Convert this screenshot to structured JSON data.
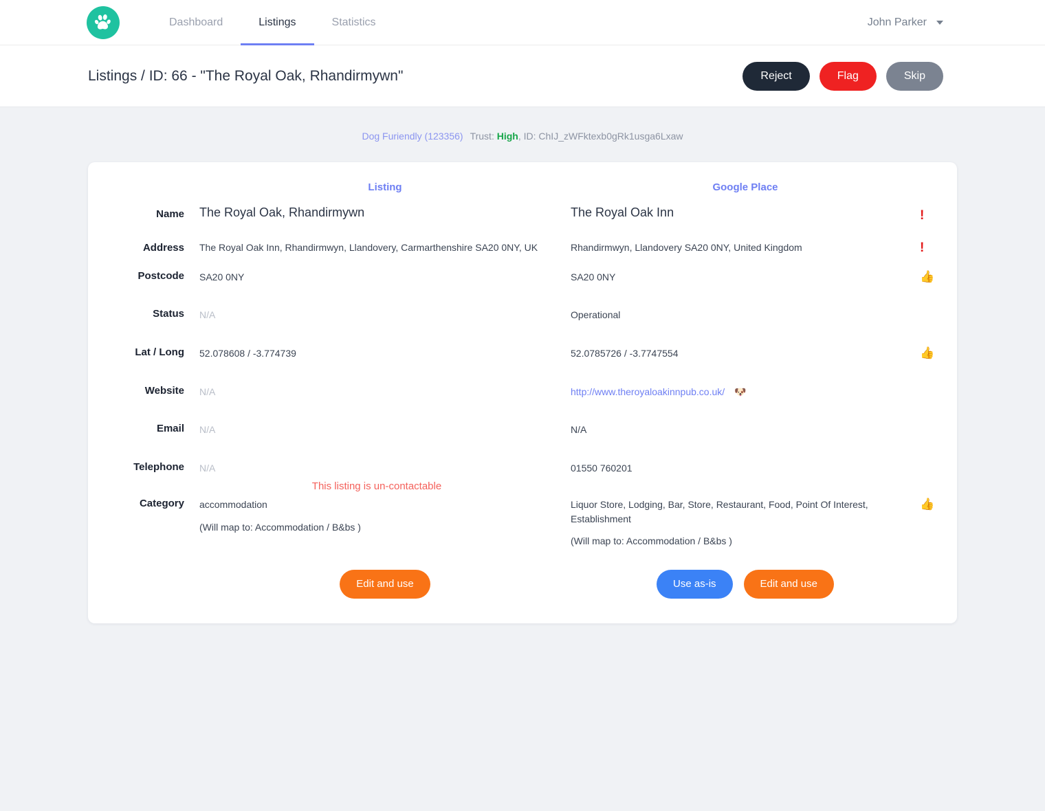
{
  "nav": {
    "logo_icon": "paw-print-icon",
    "brand_color": "#1fc2a0",
    "links": [
      {
        "label": "Dashboard",
        "active": false
      },
      {
        "label": "Listings",
        "active": true
      },
      {
        "label": "Statistics",
        "active": false
      }
    ],
    "user": "John Parker",
    "caret_icon": "chevron-down-icon"
  },
  "page": {
    "title": "Listings / ID: 66 - \"The Royal Oak, Rhandirmywn\"",
    "actions": [
      {
        "label": "Reject",
        "color": "#1f2937"
      },
      {
        "label": "Flag",
        "color": "#ef2222"
      },
      {
        "label": "Skip",
        "color": "#7b8391"
      }
    ]
  },
  "meta": {
    "brand": "Dog Furiendly (123356)",
    "trust_label": "Trust:",
    "trust_value": "High",
    "trust_color": "#18a64a",
    "id_label": ", ID: ChIJ_zWFktexb0gRk1usga6Lxaw"
  },
  "compare": {
    "col_listing": "Listing",
    "col_google": "Google Place",
    "rows": [
      {
        "label": "Name",
        "listing": "The Royal Oak, Rhandirmywn",
        "google": "The Royal Oak Inn",
        "status": "!",
        "status_kind": "warn"
      },
      {
        "label": "Address",
        "listing": "The Royal Oak Inn, Rhandirmwyn, Llandovery, Carmarthenshire SA20 0NY, UK",
        "google": "Rhandirmwyn, Llandovery SA20 0NY, United Kingdom",
        "status": "!",
        "status_kind": "warn"
      },
      {
        "label": "Postcode",
        "listing": "SA20 0NY",
        "google": "SA20 0NY",
        "status": "👍",
        "status_kind": "ok"
      },
      {
        "label": "Status",
        "listing": "N/A",
        "google": "Operational",
        "status": "",
        "status_kind": "none"
      },
      {
        "label": "Lat / Long",
        "listing": "52.078608 / -3.774739",
        "google": "52.0785726 / -3.7747554",
        "status": "👍",
        "status_kind": "ok"
      },
      {
        "label": "Website",
        "listing": "N/A",
        "google": "http://www.theroyaloakinnpub.co.uk/",
        "google_is_link": true,
        "google_suffix_icon": "dog-face-icon",
        "google_suffix": "🐶",
        "status": "",
        "status_kind": "none"
      },
      {
        "label": "Email",
        "listing": "N/A",
        "google": "N/A",
        "status": "",
        "status_kind": "none"
      },
      {
        "label": "Telephone",
        "listing": "N/A",
        "google": "01550 760201",
        "status": "",
        "status_kind": "none",
        "note": "This listing is un-contactable"
      },
      {
        "label": "Category",
        "listing": "accommodation",
        "listing_sub": "(Will map to: Accommodation / B&bs )",
        "google": "Liquor Store, Lodging, Bar, Store, Restaurant, Food, Point Of Interest, Establishment",
        "google_sub": "(Will map to: Accommodation / B&bs )",
        "status": "👍",
        "status_kind": "ok"
      }
    ],
    "footer": {
      "listing_edit": "Edit and use",
      "google_use_as_is": "Use as-is",
      "google_edit": "Edit and use"
    }
  }
}
